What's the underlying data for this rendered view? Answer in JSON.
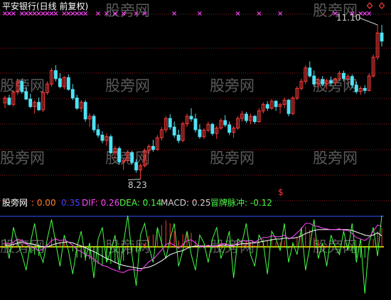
{
  "header": {
    "title": "平安银行(日线 前复权)",
    "title_color": "#ffffff"
  },
  "watermark": {
    "text": "股旁网",
    "color": "#5a5a5a"
  },
  "colors": {
    "up": "#ff3b3b",
    "down": "#4fe3f5",
    "grid": "#8b1d1d",
    "marker": "#ff44ff",
    "signal": "#ffff00",
    "dif": "#ff44ff",
    "dea": "#ffffff",
    "osc": "#44ff44",
    "hist_up": "#ff3b3b",
    "hist_down": "#44ff44",
    "hline_blue": "#3355ff",
    "hline_yellow": "#ffff00",
    "label_gray": "#cfcfcf"
  },
  "annotations": {
    "high_label": "11.10",
    "low_label": "8.23",
    "signal_symbol": "$"
  },
  "indicator_bar": {
    "name": "股旁网",
    "v1_label": ": 0.00",
    "v2_label": "0.35",
    "dif_label": "DIF: 0.26",
    "dea_label": "DEA: 0.14",
    "macd_label": "MACD: 0.25",
    "osc_label": "冒牌脉冲: -0.12",
    "v1_color": "#ff7f27",
    "v2_color": "#4040ff",
    "dif_color": "#ff44ff",
    "dea_color": "#44ff44",
    "macd_color": "#cfcfcf",
    "osc_color": "#44ff44"
  },
  "chart_data": {
    "type": "candlestick",
    "title": "平安银行(日线 前复权)",
    "price_range": [
      8.0,
      11.3
    ],
    "annotated_high": 11.1,
    "annotated_low": 8.23,
    "candles_ohlc": [
      [
        9.65,
        9.78,
        9.55,
        9.74
      ],
      [
        9.74,
        9.8,
        9.6,
        9.62
      ],
      [
        9.62,
        9.88,
        9.58,
        9.85
      ],
      [
        9.85,
        10.1,
        9.8,
        10.05
      ],
      [
        10.05,
        10.08,
        9.82,
        9.86
      ],
      [
        9.86,
        9.95,
        9.7,
        9.72
      ],
      [
        9.72,
        9.82,
        9.55,
        9.58
      ],
      [
        9.58,
        9.7,
        9.45,
        9.66
      ],
      [
        9.66,
        9.75,
        9.5,
        9.52
      ],
      [
        9.52,
        9.88,
        9.48,
        9.84
      ],
      [
        9.84,
        10.05,
        9.8,
        10.0
      ],
      [
        10.0,
        10.3,
        9.95,
        10.25
      ],
      [
        10.25,
        10.35,
        10.05,
        10.1
      ],
      [
        10.1,
        10.2,
        9.92,
        9.95
      ],
      [
        9.95,
        10.15,
        9.9,
        10.12
      ],
      [
        10.12,
        10.18,
        9.88,
        9.9
      ],
      [
        9.9,
        10.0,
        9.7,
        9.74
      ],
      [
        9.74,
        9.8,
        9.52,
        9.55
      ],
      [
        9.55,
        9.7,
        9.48,
        9.66
      ],
      [
        9.66,
        9.7,
        9.3,
        9.35
      ],
      [
        9.35,
        9.45,
        9.2,
        9.4
      ],
      [
        9.4,
        9.44,
        9.1,
        9.15
      ],
      [
        9.15,
        9.25,
        9.0,
        9.05
      ],
      [
        9.05,
        9.12,
        8.9,
        8.95
      ],
      [
        8.95,
        9.08,
        8.85,
        9.02
      ],
      [
        9.02,
        9.06,
        8.7,
        8.72
      ],
      [
        8.72,
        8.85,
        8.6,
        8.8
      ],
      [
        8.8,
        8.84,
        8.5,
        8.55
      ],
      [
        8.55,
        8.62,
        8.4,
        8.58
      ],
      [
        8.58,
        8.76,
        8.52,
        8.72
      ],
      [
        8.72,
        8.76,
        8.5,
        8.54
      ],
      [
        8.54,
        8.6,
        8.35,
        8.4
      ],
      [
        8.4,
        8.52,
        8.23,
        8.48
      ],
      [
        8.48,
        8.8,
        8.45,
        8.76
      ],
      [
        8.76,
        8.88,
        8.7,
        8.84
      ],
      [
        8.84,
        8.96,
        8.74,
        8.78
      ],
      [
        8.78,
        9.05,
        8.76,
        9.0
      ],
      [
        9.0,
        9.2,
        8.95,
        9.15
      ],
      [
        9.15,
        9.4,
        9.1,
        9.36
      ],
      [
        9.36,
        9.44,
        9.15,
        9.2
      ],
      [
        9.2,
        9.3,
        9.0,
        9.05
      ],
      [
        9.05,
        9.15,
        8.9,
        8.95
      ],
      [
        8.95,
        9.3,
        8.92,
        9.26
      ],
      [
        9.26,
        9.45,
        9.2,
        9.4
      ],
      [
        9.4,
        9.55,
        9.3,
        9.35
      ],
      [
        9.35,
        9.45,
        9.1,
        9.15
      ],
      [
        9.15,
        9.25,
        8.98,
        9.02
      ],
      [
        9.02,
        9.18,
        8.98,
        9.14
      ],
      [
        9.14,
        9.3,
        9.1,
        9.25
      ],
      [
        9.25,
        9.28,
        9.04,
        9.08
      ],
      [
        9.08,
        9.22,
        8.98,
        9.18
      ],
      [
        9.18,
        9.36,
        9.15,
        9.32
      ],
      [
        9.32,
        9.42,
        9.2,
        9.24
      ],
      [
        9.24,
        9.3,
        9.05,
        9.1
      ],
      [
        9.1,
        9.22,
        9.0,
        9.18
      ],
      [
        9.18,
        9.4,
        9.15,
        9.36
      ],
      [
        9.36,
        9.5,
        9.3,
        9.44
      ],
      [
        9.44,
        9.48,
        9.28,
        9.32
      ],
      [
        9.32,
        9.45,
        9.25,
        9.4
      ],
      [
        9.4,
        9.42,
        9.26,
        9.3
      ],
      [
        9.3,
        9.55,
        9.28,
        9.5
      ],
      [
        9.5,
        9.66,
        9.45,
        9.62
      ],
      [
        9.62,
        9.68,
        9.5,
        9.55
      ],
      [
        9.55,
        9.72,
        9.52,
        9.68
      ],
      [
        9.68,
        9.7,
        9.5,
        9.58
      ],
      [
        9.58,
        9.65,
        9.45,
        9.62
      ],
      [
        9.62,
        9.75,
        9.55,
        9.7
      ],
      [
        9.7,
        9.72,
        9.4,
        9.45
      ],
      [
        9.45,
        9.78,
        9.42,
        9.74
      ],
      [
        9.74,
        9.96,
        9.7,
        9.92
      ],
      [
        9.92,
        10.1,
        9.88,
        10.05
      ],
      [
        10.05,
        10.35,
        10.0,
        10.3
      ],
      [
        10.3,
        10.42,
        10.12,
        10.15
      ],
      [
        10.15,
        10.25,
        9.95,
        10.0
      ],
      [
        10.0,
        10.12,
        9.92,
        10.08
      ],
      [
        10.08,
        10.15,
        9.96,
        10.0
      ],
      [
        10.0,
        10.1,
        9.9,
        10.06
      ],
      [
        10.06,
        10.14,
        9.96,
        10.02
      ],
      [
        10.02,
        10.12,
        9.98,
        10.1
      ],
      [
        10.1,
        10.24,
        10.05,
        10.2
      ],
      [
        10.2,
        10.25,
        10.05,
        10.1
      ],
      [
        10.1,
        10.18,
        10.0,
        10.14
      ],
      [
        10.14,
        10.18,
        9.92,
        9.98
      ],
      [
        9.98,
        10.05,
        9.82,
        9.86
      ],
      [
        9.86,
        9.96,
        9.8,
        9.92
      ],
      [
        9.92,
        9.98,
        9.82,
        9.88
      ],
      [
        9.88,
        10.2,
        9.86,
        10.15
      ],
      [
        10.15,
        10.55,
        10.12,
        10.5
      ],
      [
        10.5,
        11.1,
        10.45,
        10.95
      ],
      [
        10.95,
        11.1,
        10.7,
        10.8
      ]
    ],
    "indicator": {
      "name": "股旁网",
      "values": {
        "V1": 0.0,
        "V2": 0.35,
        "DIF": 0.26,
        "DEA": 0.14,
        "MACD": 0.25,
        "冒牌脉冲": -0.12
      },
      "dif_series": [
        0.05,
        0.04,
        0.06,
        0.1,
        0.08,
        0.04,
        0.0,
        -0.02,
        -0.05,
        -0.03,
        0.02,
        0.08,
        0.1,
        0.08,
        0.09,
        0.06,
        0.02,
        -0.04,
        -0.06,
        -0.1,
        -0.12,
        -0.16,
        -0.2,
        -0.24,
        -0.25,
        -0.28,
        -0.3,
        -0.32,
        -0.33,
        -0.3,
        -0.29,
        -0.3,
        -0.31,
        -0.25,
        -0.19,
        -0.16,
        -0.1,
        -0.04,
        0.03,
        0.05,
        0.02,
        -0.02,
        0.03,
        0.08,
        0.09,
        0.05,
        0.0,
        0.0,
        0.02,
        0.0,
        0.01,
        0.04,
        0.04,
        0.01,
        0.01,
        0.05,
        0.08,
        0.07,
        0.08,
        0.06,
        0.09,
        0.12,
        0.12,
        0.14,
        0.13,
        0.13,
        0.15,
        0.1,
        0.13,
        0.18,
        0.23,
        0.3,
        0.3,
        0.27,
        0.26,
        0.24,
        0.23,
        0.22,
        0.22,
        0.23,
        0.21,
        0.21,
        0.17,
        0.12,
        0.1,
        0.08,
        0.12,
        0.2,
        0.28,
        0.26
      ],
      "dea_series": [
        0.02,
        0.02,
        0.03,
        0.05,
        0.06,
        0.05,
        0.04,
        0.03,
        0.01,
        0.0,
        0.0,
        0.02,
        0.04,
        0.05,
        0.06,
        0.06,
        0.05,
        0.03,
        0.01,
        -0.01,
        -0.04,
        -0.06,
        -0.09,
        -0.12,
        -0.15,
        -0.17,
        -0.2,
        -0.22,
        -0.24,
        -0.25,
        -0.26,
        -0.27,
        -0.28,
        -0.27,
        -0.26,
        -0.24,
        -0.21,
        -0.18,
        -0.14,
        -0.1,
        -0.08,
        -0.06,
        -0.05,
        -0.02,
        0.0,
        0.01,
        0.01,
        0.01,
        0.01,
        0.01,
        0.01,
        0.02,
        0.02,
        0.02,
        0.02,
        0.03,
        0.04,
        0.04,
        0.05,
        0.05,
        0.06,
        0.07,
        0.08,
        0.09,
        0.1,
        0.1,
        0.11,
        0.11,
        0.11,
        0.12,
        0.14,
        0.17,
        0.19,
        0.21,
        0.22,
        0.22,
        0.22,
        0.22,
        0.22,
        0.22,
        0.22,
        0.22,
        0.21,
        0.19,
        0.17,
        0.15,
        0.14,
        0.15,
        0.18,
        0.14
      ],
      "osc_series": [
        0.1,
        -0.15,
        0.25,
        0.05,
        -0.1,
        -0.3,
        0.05,
        0.3,
        -0.05,
        -0.2,
        0.1,
        0.35,
        0.05,
        -0.25,
        0.15,
        -0.05,
        -0.35,
        0.0,
        0.2,
        -0.15,
        0.05,
        -0.4,
        0.1,
        0.25,
        -0.2,
        -0.05,
        0.15,
        -0.3,
        0.05,
        0.4,
        -0.1,
        -0.5,
        0.15,
        0.3,
        0.0,
        -0.2,
        0.25,
        0.05,
        -0.15,
        0.1,
        0.3,
        -0.25,
        -0.05,
        0.2,
        -0.1,
        -0.3,
        0.15,
        0.05,
        -0.2,
        0.1,
        0.25,
        -0.15,
        0.0,
        0.2,
        -0.4,
        0.1,
        0.05,
        0.3,
        -0.1,
        -0.25,
        0.15,
        0.05,
        -0.35,
        0.2,
        0.1,
        -0.05,
        0.3,
        -0.2,
        0.05,
        -0.1,
        0.25,
        -0.3,
        0.0,
        0.35,
        -0.15,
        0.05,
        -0.25,
        0.15,
        0.0,
        -0.1,
        0.2,
        -0.05,
        0.3,
        -0.2,
        0.1,
        -0.6,
        0.05,
        0.25,
        -0.12,
        0.4
      ]
    }
  }
}
